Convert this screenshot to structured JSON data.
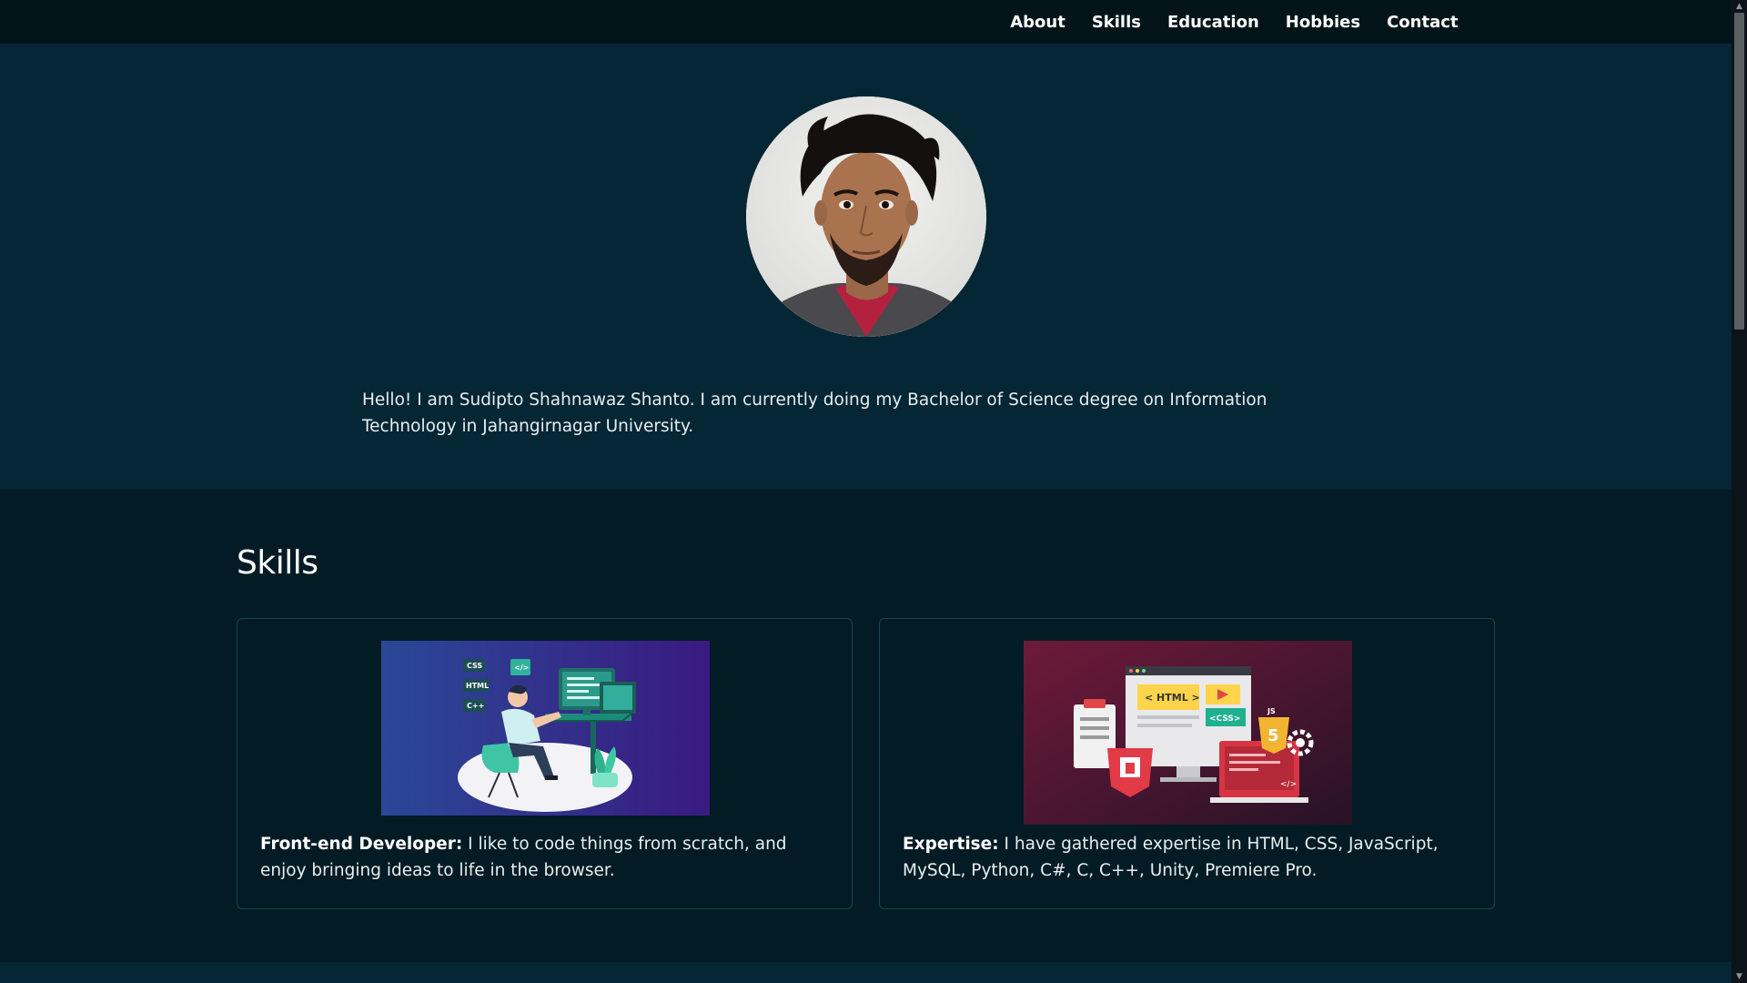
{
  "nav": {
    "items": [
      {
        "label": "About"
      },
      {
        "label": "Skills"
      },
      {
        "label": "Education"
      },
      {
        "label": "Hobbies"
      },
      {
        "label": "Contact"
      }
    ]
  },
  "hero": {
    "intro": "Hello! I am Sudipto Shahnawaz Shanto. I am currently doing my Bachelor of Science degree on Information Technology in Jahangirnagar University."
  },
  "skills": {
    "title": "Skills",
    "cards": [
      {
        "heading": "Front-end Developer:",
        "text": " I like to code things from scratch, and enjoy bringing ideas to life in the browser.",
        "illustration_labels": [
          "CSS",
          "HTML",
          "C++",
          "</>"
        ]
      },
      {
        "heading": "Expertise:",
        "text": " I have gathered expertise in HTML, CSS, JavaScript, MySQL, Python, C#, C, C++, Unity, Premiere Pro.",
        "illustration_labels": [
          "< HTML >",
          "<CSS>",
          "JS",
          "5",
          "</>"
        ]
      }
    ]
  },
  "colors": {
    "navbar": "#031419",
    "hero_bg": "#052634",
    "skills_bg": "#031b24",
    "card_border": "#14465a"
  }
}
